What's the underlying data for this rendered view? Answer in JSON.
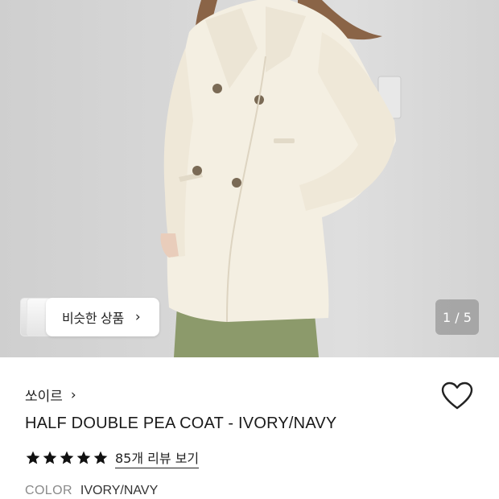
{
  "hero": {
    "similar_products_label": "비슷한 상품",
    "pager": "1 / 5"
  },
  "product": {
    "brand": "쏘이르",
    "title": "HALF DOUBLE PEA COAT - IVORY/NAVY",
    "rating_stars": 5,
    "reviews_link": "85개 리뷰 보기",
    "color_label": "COLOR",
    "color_value": "IVORY/NAVY"
  },
  "icons": {
    "chevron": "›",
    "heart": "heart-outline-icon",
    "star": "star-filled-icon"
  },
  "colors": {
    "background": "#ffffff",
    "text": "#1a1a1a",
    "muted": "#8a8a8a",
    "coat": "#f4efe2",
    "skirt": "#8c9a6b"
  }
}
